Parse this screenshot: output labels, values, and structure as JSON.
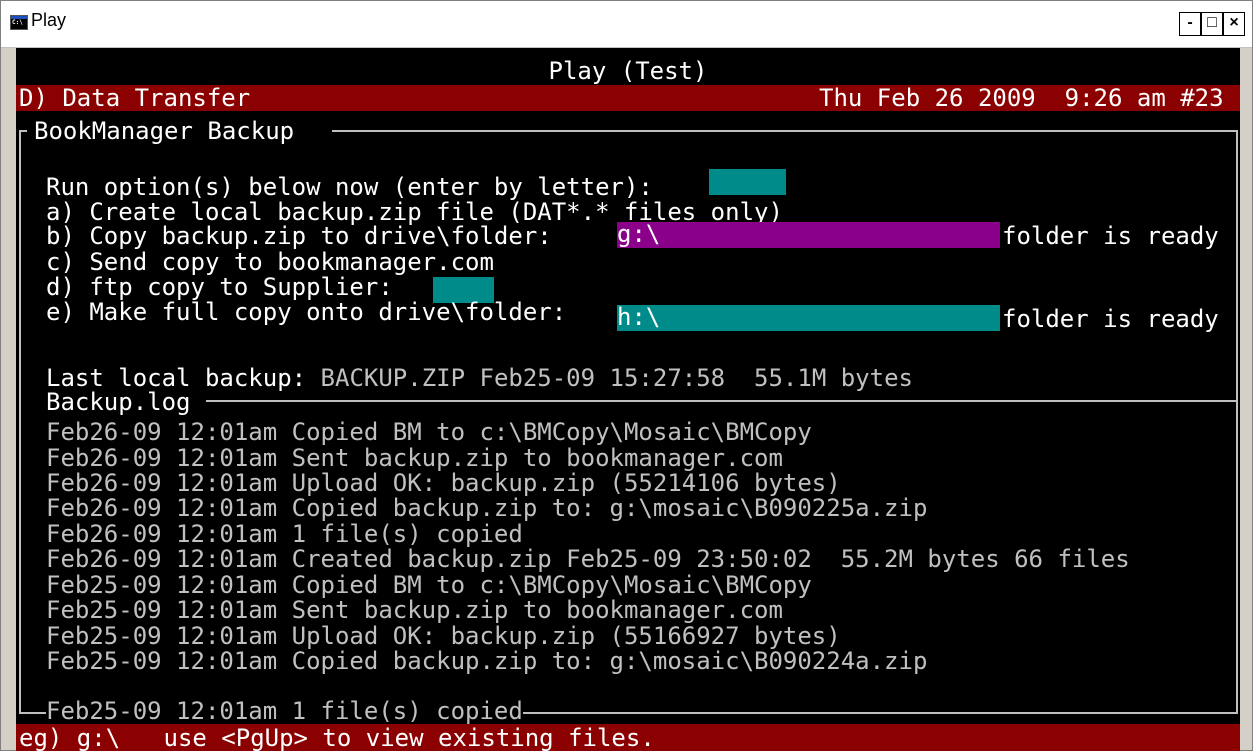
{
  "window": {
    "title": "Play",
    "minimize_label": "-",
    "maximize_label": "□",
    "close_label": "×"
  },
  "header": {
    "program_title": "Play (Test)",
    "menu_label": "D) Data Transfer",
    "datetime": "Thu Feb 26 2009  9:26 am #23"
  },
  "panel": {
    "title": "BookManager Backup",
    "prompt": "Run option(s) below now (enter by letter):",
    "options": [
      "a) Create local backup.zip file (DAT*.* files only)",
      "b) Copy backup.zip to drive\\folder:",
      "c) Send copy to bookmanager.com",
      "d) ftp copy to Supplier:",
      "e) Make full copy onto drive\\folder:"
    ],
    "option_b_value": "g:\\",
    "option_b_status": "folder is ready",
    "option_e_value": "h:\\",
    "option_e_status": "folder is ready",
    "last_backup_label": "Last local backup:",
    "last_backup_value": "BACKUP.ZIP Feb25-09 15:27:58  55.1M bytes"
  },
  "log": {
    "title": "Backup.log",
    "entries": [
      "Feb26-09 12:01am Copied BM to c:\\BMCopy\\Mosaic\\BMCopy",
      "Feb26-09 12:01am Sent backup.zip to bookmanager.com",
      "Feb26-09 12:01am Upload OK: backup.zip (55214106 bytes)",
      "Feb26-09 12:01am Copied backup.zip to: g:\\mosaic\\B090225a.zip",
      "Feb26-09 12:01am 1 file(s) copied",
      "Feb26-09 12:01am Created backup.zip Feb25-09 23:50:02  55.2M bytes 66 files",
      "Feb25-09 12:01am Copied BM to c:\\BMCopy\\Mosaic\\BMCopy",
      "Feb25-09 12:01am Sent backup.zip to bookmanager.com",
      "Feb25-09 12:01am Upload OK: backup.zip (55166927 bytes)",
      "Feb25-09 12:01am Copied backup.zip to: g:\\mosaic\\B090224a.zip",
      "Feb25-09 12:01am 1 file(s) copied"
    ]
  },
  "status_bar": {
    "text": "eg) g:\\   use <PgUp> to view existing files."
  },
  "colors": {
    "console_bg": "#000000",
    "text": "#c0c0c0",
    "bright_text": "#ffffff",
    "header_bar": "#8b0000",
    "input_teal": "#008b8b",
    "input_purple": "#8b008b"
  },
  "icons": {
    "app": "console-window-icon"
  }
}
